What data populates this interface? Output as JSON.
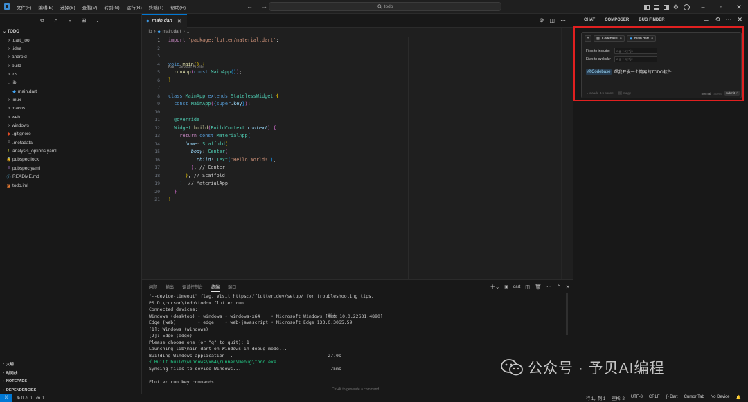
{
  "titlebar": {
    "menu": [
      "文件(F)",
      "编辑(E)",
      "选择(S)",
      "查看(V)",
      "转到(G)",
      "运行(R)",
      "终端(T)",
      "帮助(H)"
    ],
    "search_text": "todo"
  },
  "explorer": {
    "header": "TODO",
    "items": [
      {
        "label": ".dart_tool",
        "type": "folder",
        "indent": 0
      },
      {
        "label": ".idea",
        "type": "folder",
        "indent": 0
      },
      {
        "label": "android",
        "type": "folder",
        "indent": 0
      },
      {
        "label": "build",
        "type": "folder",
        "indent": 0
      },
      {
        "label": "ios",
        "type": "folder",
        "indent": 0
      },
      {
        "label": "lib",
        "type": "folder-open",
        "indent": 0
      },
      {
        "label": "main.dart",
        "type": "dart",
        "indent": 1
      },
      {
        "label": "linux",
        "type": "folder",
        "indent": 0
      },
      {
        "label": "macos",
        "type": "folder",
        "indent": 0
      },
      {
        "label": "web",
        "type": "folder",
        "indent": 0
      },
      {
        "label": "windows",
        "type": "folder",
        "indent": 0
      },
      {
        "label": ".gitignore",
        "type": "git",
        "indent": 0
      },
      {
        "label": ".metadata",
        "type": "meta",
        "indent": 0
      },
      {
        "label": "analysis_options.yaml",
        "type": "yaml-excl",
        "indent": 0
      },
      {
        "label": "pubspec.lock",
        "type": "lock",
        "indent": 0
      },
      {
        "label": "pubspec.yaml",
        "type": "yaml",
        "indent": 0
      },
      {
        "label": "README.md",
        "type": "info",
        "indent": 0
      },
      {
        "label": "todo.iml",
        "type": "iml",
        "indent": 0
      }
    ],
    "sections": [
      "大纲",
      "时间线",
      "NOTEPADS",
      "DEPENDENCIES"
    ]
  },
  "editor": {
    "tab_label": "main.dart",
    "breadcrumb": [
      "lib",
      "main.dart",
      "..."
    ],
    "codelens": "Run | Debug | Profile",
    "line_numbers": [
      "1",
      "2",
      "3",
      "4",
      "5",
      "6",
      "7",
      "8",
      "9",
      "10",
      "11",
      "12",
      "13",
      "14",
      "15",
      "16",
      "17",
      "18",
      "19",
      "20",
      "21"
    ]
  },
  "panel": {
    "tabs": [
      "问题",
      "输出",
      "调试控制台",
      "终端",
      "端口"
    ],
    "active_tab": "终端",
    "terminal_name": "dart",
    "lines": [
      "\"--device-timeout\" flag. Visit https://flutter.dev/setup/ for troubleshooting tips.",
      "PS D:\\cursor\\todo\\todo> flutter run",
      "Connected devices:",
      "Windows (desktop) • windows • windows-x64    • Microsoft Windows [版本 10.0.22631.4890]",
      "Edge (web)        • edge    • web-javascript • Microsoft Edge 133.0.3065.59",
      "[1]: Windows (windows)",
      "[2]: Edge (edge)",
      "Please choose one (or \"q\" to quit): 1",
      "Launching lib\\main.dart on Windows in debug mode...",
      "Building Windows application...                                   27.0s",
      "√ Built build\\windows\\x64\\runner\\Debug\\todo.exe",
      "Syncing files to device Windows...                                 75ms",
      "",
      "Flutter run key commands."
    ],
    "hint": "Ctrl+K to generate a command"
  },
  "chat": {
    "tabs": [
      "CHAT",
      "COMPOSER",
      "BUG FINDER"
    ],
    "context_pills": [
      "Codebase",
      "main.dart"
    ],
    "files_include_label": "Files to include:",
    "files_include_placeholder": "e.g. *.py,*.js",
    "files_exclude_label": "Files to exclude:",
    "files_exclude_placeholder": "e.g. *.py,*.js",
    "mention": "@Codebase",
    "message": "帮我开发一个简易的TODO软件",
    "model": "claude-3.5-sonnet",
    "image_label": "image",
    "mode_normal": "normal",
    "mode_agent": "agent",
    "submit_label": "submit"
  },
  "statusbar": {
    "errors_warnings": "⊗ 0 ⚠ 0",
    "ports": "ꝏ 0",
    "position": "行 1，列 1",
    "spaces": "空格: 2",
    "encoding": "UTF-8",
    "eol": "CRLF",
    "language": "{} Dart",
    "cursor_tab": "Cursor Tab",
    "device": "No Device"
  },
  "watermark": {
    "text": "公众号 · 予贝AI编程"
  },
  "colors": {
    "accent": "#0078d4",
    "highlight_border": "#e02020",
    "background": "#1f1f1f"
  }
}
